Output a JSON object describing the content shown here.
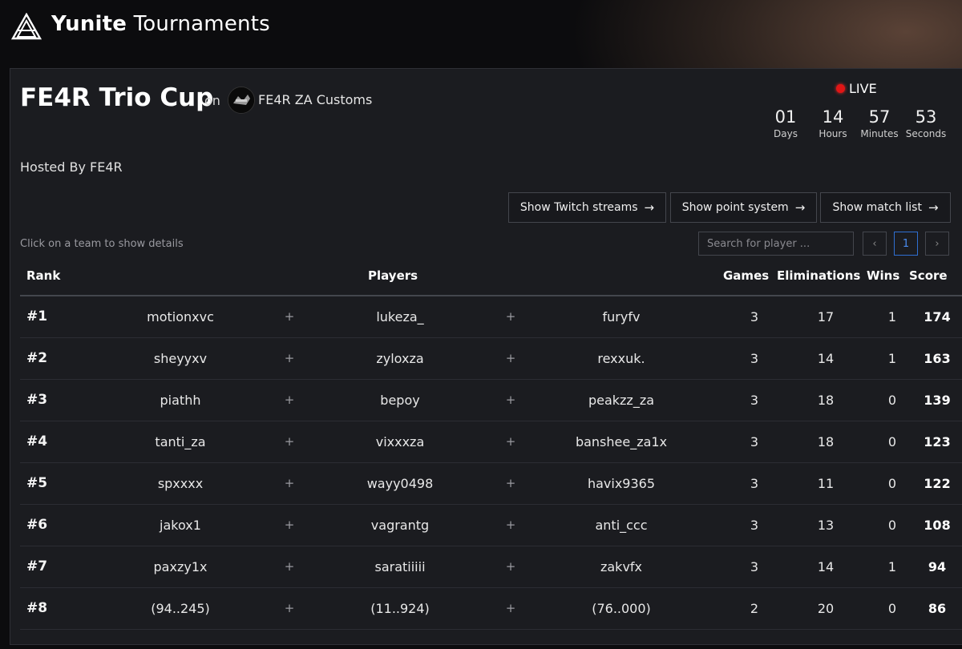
{
  "app": {
    "brand_bold": "Yunite",
    "brand_light": "Tournaments"
  },
  "tournament": {
    "title": "FE4R Trio Cup",
    "on_label": "on",
    "org_name": "FE4R ZA Customs",
    "hosted_by": "Hosted By FE4R"
  },
  "status": {
    "live_label": "LIVE",
    "countdown": [
      {
        "value": "01",
        "label": "Days"
      },
      {
        "value": "14",
        "label": "Hours"
      },
      {
        "value": "57",
        "label": "Minutes"
      },
      {
        "value": "53",
        "label": "Seconds"
      }
    ]
  },
  "actions": {
    "twitch": "Show Twitch streams",
    "points": "Show point system",
    "matches": "Show match list",
    "arrow": "→"
  },
  "table_tools": {
    "hint": "Click on a team to show details",
    "search_placeholder": "Search for player ...",
    "prev": "‹",
    "page": "1",
    "next": "›"
  },
  "table": {
    "headers": {
      "rank": "Rank",
      "players": "Players",
      "games": "Games",
      "eliminations": "Eliminations",
      "wins": "Wins",
      "score": "Score"
    },
    "plus": "+",
    "rows": [
      {
        "rank": "#1",
        "p1": "motionxvc",
        "p2": "lukeza_",
        "p3": "furyfv",
        "games": "3",
        "elims": "17",
        "wins": "1",
        "score": "174"
      },
      {
        "rank": "#2",
        "p1": "sheyyxv",
        "p2": "zyloxza",
        "p3": "rexxuk.",
        "games": "3",
        "elims": "14",
        "wins": "1",
        "score": "163"
      },
      {
        "rank": "#3",
        "p1": "piathh",
        "p2": "bepoy",
        "p3": "peakzz_za",
        "games": "3",
        "elims": "18",
        "wins": "0",
        "score": "139"
      },
      {
        "rank": "#4",
        "p1": "tanti_za",
        "p2": "vixxxza",
        "p3": "banshee_za1x",
        "games": "3",
        "elims": "18",
        "wins": "0",
        "score": "123"
      },
      {
        "rank": "#5",
        "p1": "spxxxx",
        "p2": "wayy0498",
        "p3": "havix9365",
        "games": "3",
        "elims": "11",
        "wins": "0",
        "score": "122"
      },
      {
        "rank": "#6",
        "p1": "jakox1",
        "p2": "vagrantg",
        "p3": "anti_ccc",
        "games": "3",
        "elims": "13",
        "wins": "0",
        "score": "108"
      },
      {
        "rank": "#7",
        "p1": "paxzy1x",
        "p2": "saratiiiii",
        "p3": "zakvfx",
        "games": "3",
        "elims": "14",
        "wins": "1",
        "score": "94"
      },
      {
        "rank": "#8",
        "p1": "(94..245)",
        "p2": "(11..924)",
        "p3": "(76..000)",
        "games": "2",
        "elims": "20",
        "wins": "0",
        "score": "86"
      }
    ]
  },
  "colors": {
    "live": "#e11515",
    "accent": "#2f6fd1",
    "panel": "#1b1c20"
  }
}
